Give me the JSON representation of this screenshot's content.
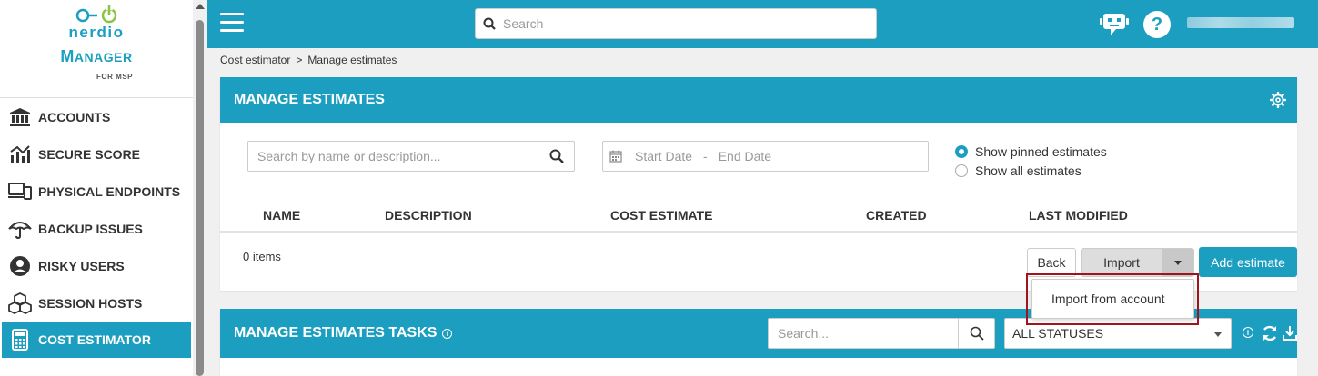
{
  "brand": {
    "name": "nerdio",
    "product_first": "M",
    "product_rest": "ANAGER",
    "edition": "FOR MSP"
  },
  "sidebar": {
    "items": [
      {
        "label": "ACCOUNTS",
        "icon": "bank-icon"
      },
      {
        "label": "SECURE SCORE",
        "icon": "chart-icon"
      },
      {
        "label": "PHYSICAL ENDPOINTS",
        "icon": "devices-icon"
      },
      {
        "label": "BACKUP ISSUES",
        "icon": "umbrella-icon"
      },
      {
        "label": "RISKY USERS",
        "icon": "user-circle-icon"
      },
      {
        "label": "SESSION HOSTS",
        "icon": "cubes-icon"
      },
      {
        "label": "COST ESTIMATOR",
        "icon": "calculator-icon",
        "active": true
      }
    ]
  },
  "topbar": {
    "search_placeholder": "Search"
  },
  "breadcrumb": {
    "parent": "Cost estimator",
    "separator": ">",
    "current": "Manage estimates"
  },
  "estimates": {
    "title": "MANAGE ESTIMATES",
    "search_placeholder": "Search by name or description...",
    "start_date": "Start Date",
    "date_sep": "-",
    "end_date": "End Date",
    "radio_pinned": "Show pinned estimates",
    "radio_all": "Show all estimates",
    "selected_radio": "pinned",
    "columns": [
      "NAME",
      "DESCRIPTION",
      "COST ESTIMATE",
      "CREATED",
      "LAST MODIFIED"
    ],
    "items_count": "0 items",
    "back_label": "Back",
    "import_label": "Import",
    "add_label": "Add estimate",
    "import_menu": [
      "Import from account"
    ]
  },
  "tasks": {
    "title": "MANAGE ESTIMATES TASKS",
    "search_placeholder": "Search...",
    "status_value": "ALL STATUSES"
  },
  "colors": {
    "accent": "#1c9ec1",
    "highlight": "#a0141d"
  }
}
